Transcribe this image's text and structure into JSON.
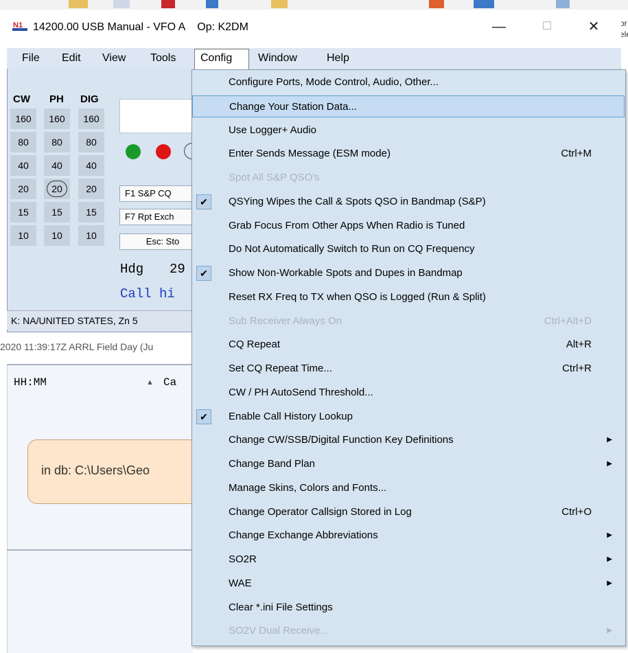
{
  "window": {
    "title": "14200.00 USB Manual - VFO A    Op: K2DM",
    "minimize_glyph": "—",
    "maximize_glyph": "☐",
    "close_glyph": "✕"
  },
  "desktop": {
    "right_cut_text": "or\nele"
  },
  "menubar": {
    "items": [
      "File",
      "Edit",
      "View",
      "Tools",
      "Config",
      "Window",
      "Help"
    ]
  },
  "bands": {
    "headers": [
      "CW",
      "PH",
      "DIG"
    ],
    "rows": [
      [
        "160",
        "160",
        "160"
      ],
      [
        "80",
        "80",
        "80"
      ],
      [
        "40",
        "40",
        "40"
      ],
      [
        "20",
        "20",
        "20"
      ],
      [
        "15",
        "15",
        "15"
      ],
      [
        "10",
        "10",
        "10"
      ]
    ],
    "selected": "20"
  },
  "fkeys": {
    "f1": "F1 S&P CQ",
    "f7": "F7 Rpt Exch",
    "esc": "Esc: Sto"
  },
  "heading": {
    "label": "Hdg",
    "value": "29"
  },
  "call_hint": "Call hi",
  "status_bar": "K: NA/UNITED STATES, Zn 5",
  "log_info": "2020 11:39:17Z  ARRL Field Day (Ju",
  "log_grid": {
    "col_time": "HH:MM",
    "col_call": "Ca",
    "sort_glyph": "▲"
  },
  "db_message": "in db: C:\\Users\\Geo",
  "config_menu": {
    "items": [
      {
        "label": "Configure Ports, Mode Control, Audio, Other...",
        "shortcut": "",
        "checked": false,
        "disabled": false,
        "submenu": false,
        "highlighted": false
      },
      {
        "label": "Change Your Station Data...",
        "shortcut": "",
        "checked": false,
        "disabled": false,
        "submenu": false,
        "highlighted": true
      },
      {
        "label": "Use Logger+ Audio",
        "shortcut": "",
        "checked": false,
        "disabled": false,
        "submenu": false,
        "highlighted": false
      },
      {
        "label": "Enter Sends Message (ESM mode)",
        "shortcut": "Ctrl+M",
        "checked": false,
        "disabled": false,
        "submenu": false,
        "highlighted": false
      },
      {
        "label": "Spot All S&P QSO's",
        "shortcut": "",
        "checked": false,
        "disabled": true,
        "submenu": false,
        "highlighted": false
      },
      {
        "label": "QSYing Wipes the Call & Spots QSO in Bandmap (S&P)",
        "shortcut": "",
        "checked": true,
        "disabled": false,
        "submenu": false,
        "highlighted": false
      },
      {
        "label": "Grab Focus From Other Apps When Radio is Tuned",
        "shortcut": "",
        "checked": false,
        "disabled": false,
        "submenu": false,
        "highlighted": false
      },
      {
        "label": "Do Not Automatically Switch to Run on CQ Frequency",
        "shortcut": "",
        "checked": false,
        "disabled": false,
        "submenu": false,
        "highlighted": false
      },
      {
        "label": "Show Non-Workable Spots and Dupes in Bandmap",
        "shortcut": "",
        "checked": true,
        "disabled": false,
        "submenu": false,
        "highlighted": false
      },
      {
        "label": "Reset RX Freq to TX when QSO is Logged (Run & Split)",
        "shortcut": "",
        "checked": false,
        "disabled": false,
        "submenu": false,
        "highlighted": false
      },
      {
        "label": "Sub Receiver Always On",
        "shortcut": "Ctrl+Alt+D",
        "checked": false,
        "disabled": true,
        "submenu": false,
        "highlighted": false
      },
      {
        "label": "CQ Repeat",
        "shortcut": "Alt+R",
        "checked": false,
        "disabled": false,
        "submenu": false,
        "highlighted": false
      },
      {
        "label": "Set CQ Repeat Time...",
        "shortcut": "Ctrl+R",
        "checked": false,
        "disabled": false,
        "submenu": false,
        "highlighted": false
      },
      {
        "label": "CW / PH AutoSend Threshold...",
        "shortcut": "",
        "checked": false,
        "disabled": false,
        "submenu": false,
        "highlighted": false
      },
      {
        "label": "Enable Call History Lookup",
        "shortcut": "",
        "checked": true,
        "disabled": false,
        "submenu": false,
        "highlighted": false
      },
      {
        "label": "Change CW/SSB/Digital Function Key Definitions",
        "shortcut": "",
        "checked": false,
        "disabled": false,
        "submenu": true,
        "highlighted": false
      },
      {
        "label": "Change Band Plan",
        "shortcut": "",
        "checked": false,
        "disabled": false,
        "submenu": true,
        "highlighted": false
      },
      {
        "label": "Manage Skins, Colors and Fonts...",
        "shortcut": "",
        "checked": false,
        "disabled": false,
        "submenu": false,
        "highlighted": false
      },
      {
        "label": "Change Operator Callsign Stored in Log",
        "shortcut": "Ctrl+O",
        "checked": false,
        "disabled": false,
        "submenu": false,
        "highlighted": false
      },
      {
        "label": "Change Exchange Abbreviations",
        "shortcut": "",
        "checked": false,
        "disabled": false,
        "submenu": true,
        "highlighted": false
      },
      {
        "label": "SO2R",
        "shortcut": "",
        "checked": false,
        "disabled": false,
        "submenu": true,
        "highlighted": false
      },
      {
        "label": "WAE",
        "shortcut": "",
        "checked": false,
        "disabled": false,
        "submenu": true,
        "highlighted": false
      },
      {
        "label": "Clear *.ini File Settings",
        "shortcut": "",
        "checked": false,
        "disabled": false,
        "submenu": false,
        "highlighted": false
      },
      {
        "label": "SO2V Dual Receive...",
        "shortcut": "",
        "checked": false,
        "disabled": true,
        "submenu": true,
        "highlighted": false
      }
    ]
  },
  "colors": {
    "window_bg": "#d9e4f1",
    "menu_bg": "#d6e4f1",
    "highlight_bg": "#c5dcf2",
    "highlight_border": "#5e9fd6",
    "disabled_text": "#a9b3bf",
    "green_led": "#1a9a2a",
    "red_led": "#e01515",
    "info_box_bg": "#fde6cb",
    "call_text": "#1d3fc4"
  }
}
